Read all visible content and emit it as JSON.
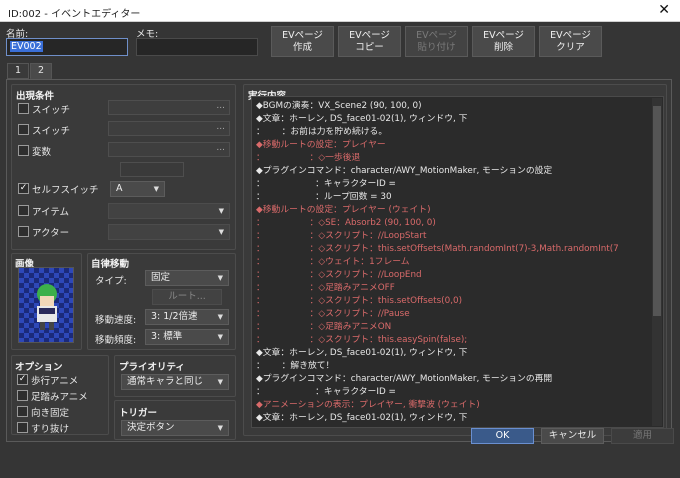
{
  "window": {
    "title": "ID:002 - イベントエディター",
    "close": "✕"
  },
  "name_label": "名前:",
  "name_value": "EV002",
  "memo_label": "メモ:",
  "top_buttons": [
    {
      "label1": "EVページ",
      "label2": "作成"
    },
    {
      "label1": "EVページ",
      "label2": "コピー"
    },
    {
      "label1": "EVページ",
      "label2": "貼り付け"
    },
    {
      "label1": "EVページ",
      "label2": "削除"
    },
    {
      "label1": "EVページ",
      "label2": "クリア"
    }
  ],
  "tabs": [
    "1",
    "2"
  ],
  "conditions": {
    "title": "出現条件",
    "switch1": "スイッチ",
    "switch2": "スイッチ",
    "variable": "変数",
    "self_switch": "セルフスイッチ",
    "self_switch_value": "A",
    "item": "アイテム",
    "actor": "アクター",
    "dots": "..."
  },
  "image": {
    "title": "画像"
  },
  "autonomous": {
    "title": "自律移動",
    "type_label": "タイプ:",
    "type_value": "固定",
    "route_button": "ルート...",
    "speed_label": "移動速度:",
    "speed_value": "3: 1/2倍速",
    "freq_label": "移動頻度:",
    "freq_value": "3: 標準"
  },
  "options": {
    "title": "オプション",
    "walk": "歩行アニメ",
    "step": "足踏みアニメ",
    "dirfix": "向き固定",
    "through": "すり抜け"
  },
  "priority": {
    "title": "プライオリティ",
    "value": "通常キャラと同じ"
  },
  "trigger": {
    "title": "トリガー",
    "value": "決定ボタン"
  },
  "contents": {
    "title": "実行内容",
    "lines": [
      {
        "t": "◆BGMの演奏：VX_Scene2 (90, 100, 0)",
        "c": "w"
      },
      {
        "t": "◆文章：ホーレン, DS_face01-02(1), ウィンドウ, 下",
        "c": "w"
      },
      {
        "t": "：      ：お前は力を貯め続ける。",
        "c": "w"
      },
      {
        "t": "◆移動ルートの設定：プレイヤー",
        "c": "r"
      },
      {
        "t": "：                ：◇一歩後退",
        "c": "r"
      },
      {
        "t": "◆プラグインコマンド：character/AWY_MotionMaker, モーションの設定",
        "c": "w"
      },
      {
        "t": "：                  ：キャラクターID =",
        "c": "w"
      },
      {
        "t": "：                  ：ループ回数 = 30",
        "c": "w"
      },
      {
        "t": "◆移動ルートの設定：プレイヤー (ウェイト)",
        "c": "r"
      },
      {
        "t": "：                ：◇SE：Absorb2 (90, 100, 0)",
        "c": "r"
      },
      {
        "t": "：                ：◇スクリプト：//LoopStart",
        "c": "r"
      },
      {
        "t": "：                ：◇スクリプト：this.setOffsets(Math.randomInt(7)-3,Math.randomInt(7",
        "c": "r"
      },
      {
        "t": "：                ：◇ウェイト：1フレーム",
        "c": "r"
      },
      {
        "t": "：                ：◇スクリプト：//LoopEnd",
        "c": "r"
      },
      {
        "t": "：                ：◇足踏みアニメOFF",
        "c": "r"
      },
      {
        "t": "：                ：◇スクリプト：this.setOffsets(0,0)",
        "c": "r"
      },
      {
        "t": "：                ：◇スクリプト：//Pause",
        "c": "r"
      },
      {
        "t": "：                ：◇足踏みアニメON",
        "c": "r"
      },
      {
        "t": "：                ：◇スクリプト：this.easySpin(false);",
        "c": "r"
      },
      {
        "t": "◆文章：ホーレン, DS_face01-02(1), ウィンドウ, 下",
        "c": "w"
      },
      {
        "t": "：      ：解き放て！",
        "c": "w"
      },
      {
        "t": "◆プラグインコマンド：character/AWY_MotionMaker, モーションの再開",
        "c": "w"
      },
      {
        "t": "：                  ：キャラクターID =",
        "c": "w"
      },
      {
        "t": "◆アニメーションの表示：プレイヤー, 衝撃波 (ウェイト)",
        "c": "r"
      },
      {
        "t": "◆文章：ホーレン, DS_face01-02(1), ウィンドウ, 下",
        "c": "w"
      }
    ]
  },
  "buttons": {
    "ok": "OK",
    "cancel": "キャンセル",
    "apply": "適用"
  }
}
